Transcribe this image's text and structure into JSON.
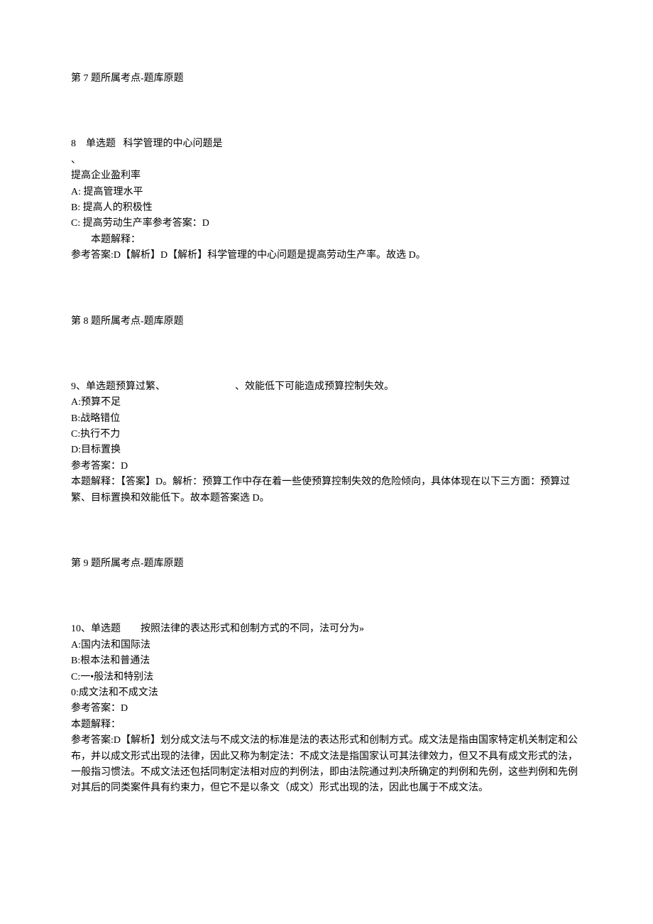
{
  "q7": {
    "source": "第 7 题所属考点-题库原题"
  },
  "q8": {
    "number_label": "8",
    "type_label": "单选题",
    "question": "科学管理的中心问题是",
    "punct": "、",
    "optA": "提高企业盈利率",
    "optB_prefix": "A:",
    "optB": " 提高管理水平",
    "optC_prefix": "B:",
    "optC": " 提高人的积极性",
    "optD_prefix": "C:",
    "optD": " 提高劳动生产率参考答案：D",
    "explain_label": "本题解释：",
    "reference_answer": "参考答案:D【解析】D【解析】科学管理的中心问题是提高劳动生产率。故选 D。",
    "source": "第 8 题所属考点-题库原题"
  },
  "q9": {
    "header": "9、单选题预算过繁、",
    "header_tail": "、效能低下可能造成预算控制失效。",
    "optA": "A:预算不足",
    "optB": "B:战略错位",
    "optC": "C:执行不力",
    "optD": "D:目标置换",
    "reference_answer_label": "参考答案：D",
    "explain": "本题解释：【答案】D。解析：预算工作中存在着一些使预算控制失效的危险倾向，具体体现在以下三方面：预算过繁、目标置换和效能低下。故本题答案选 D。",
    "source": "第 9 题所属考点-题库原题"
  },
  "q10": {
    "header": "10、单选题　　按照法律的表达形式和创制方式的不同，法可分为»",
    "optA": "A:国内法和国际法",
    "optB": "B:根本法和普通法",
    "optC": "C:一•般法和特别法",
    "optD": "0:成文法和不成文法",
    "reference_answer_label": "参考答案：D",
    "explain_label": "本题解释：",
    "explain": "参考答案:D【解析】划分成文法与不成文法的标准是法的表达形式和创制方式。成文法是指由国家特定机关制定和公布，并以成文形式出现的法律，因此又称为制定法：不成文法是指国家认可其法律效力，但又不具有成文形式的法，一般指习惯法。不成文法还包括同制定法相对应的判例法，即由法院通过判决所确定的判例和先例，这些判例和先例对其后的同类案件具有约束力，但它不是以条文（成文）形式出现的法，因此也属于不成文法。"
  }
}
